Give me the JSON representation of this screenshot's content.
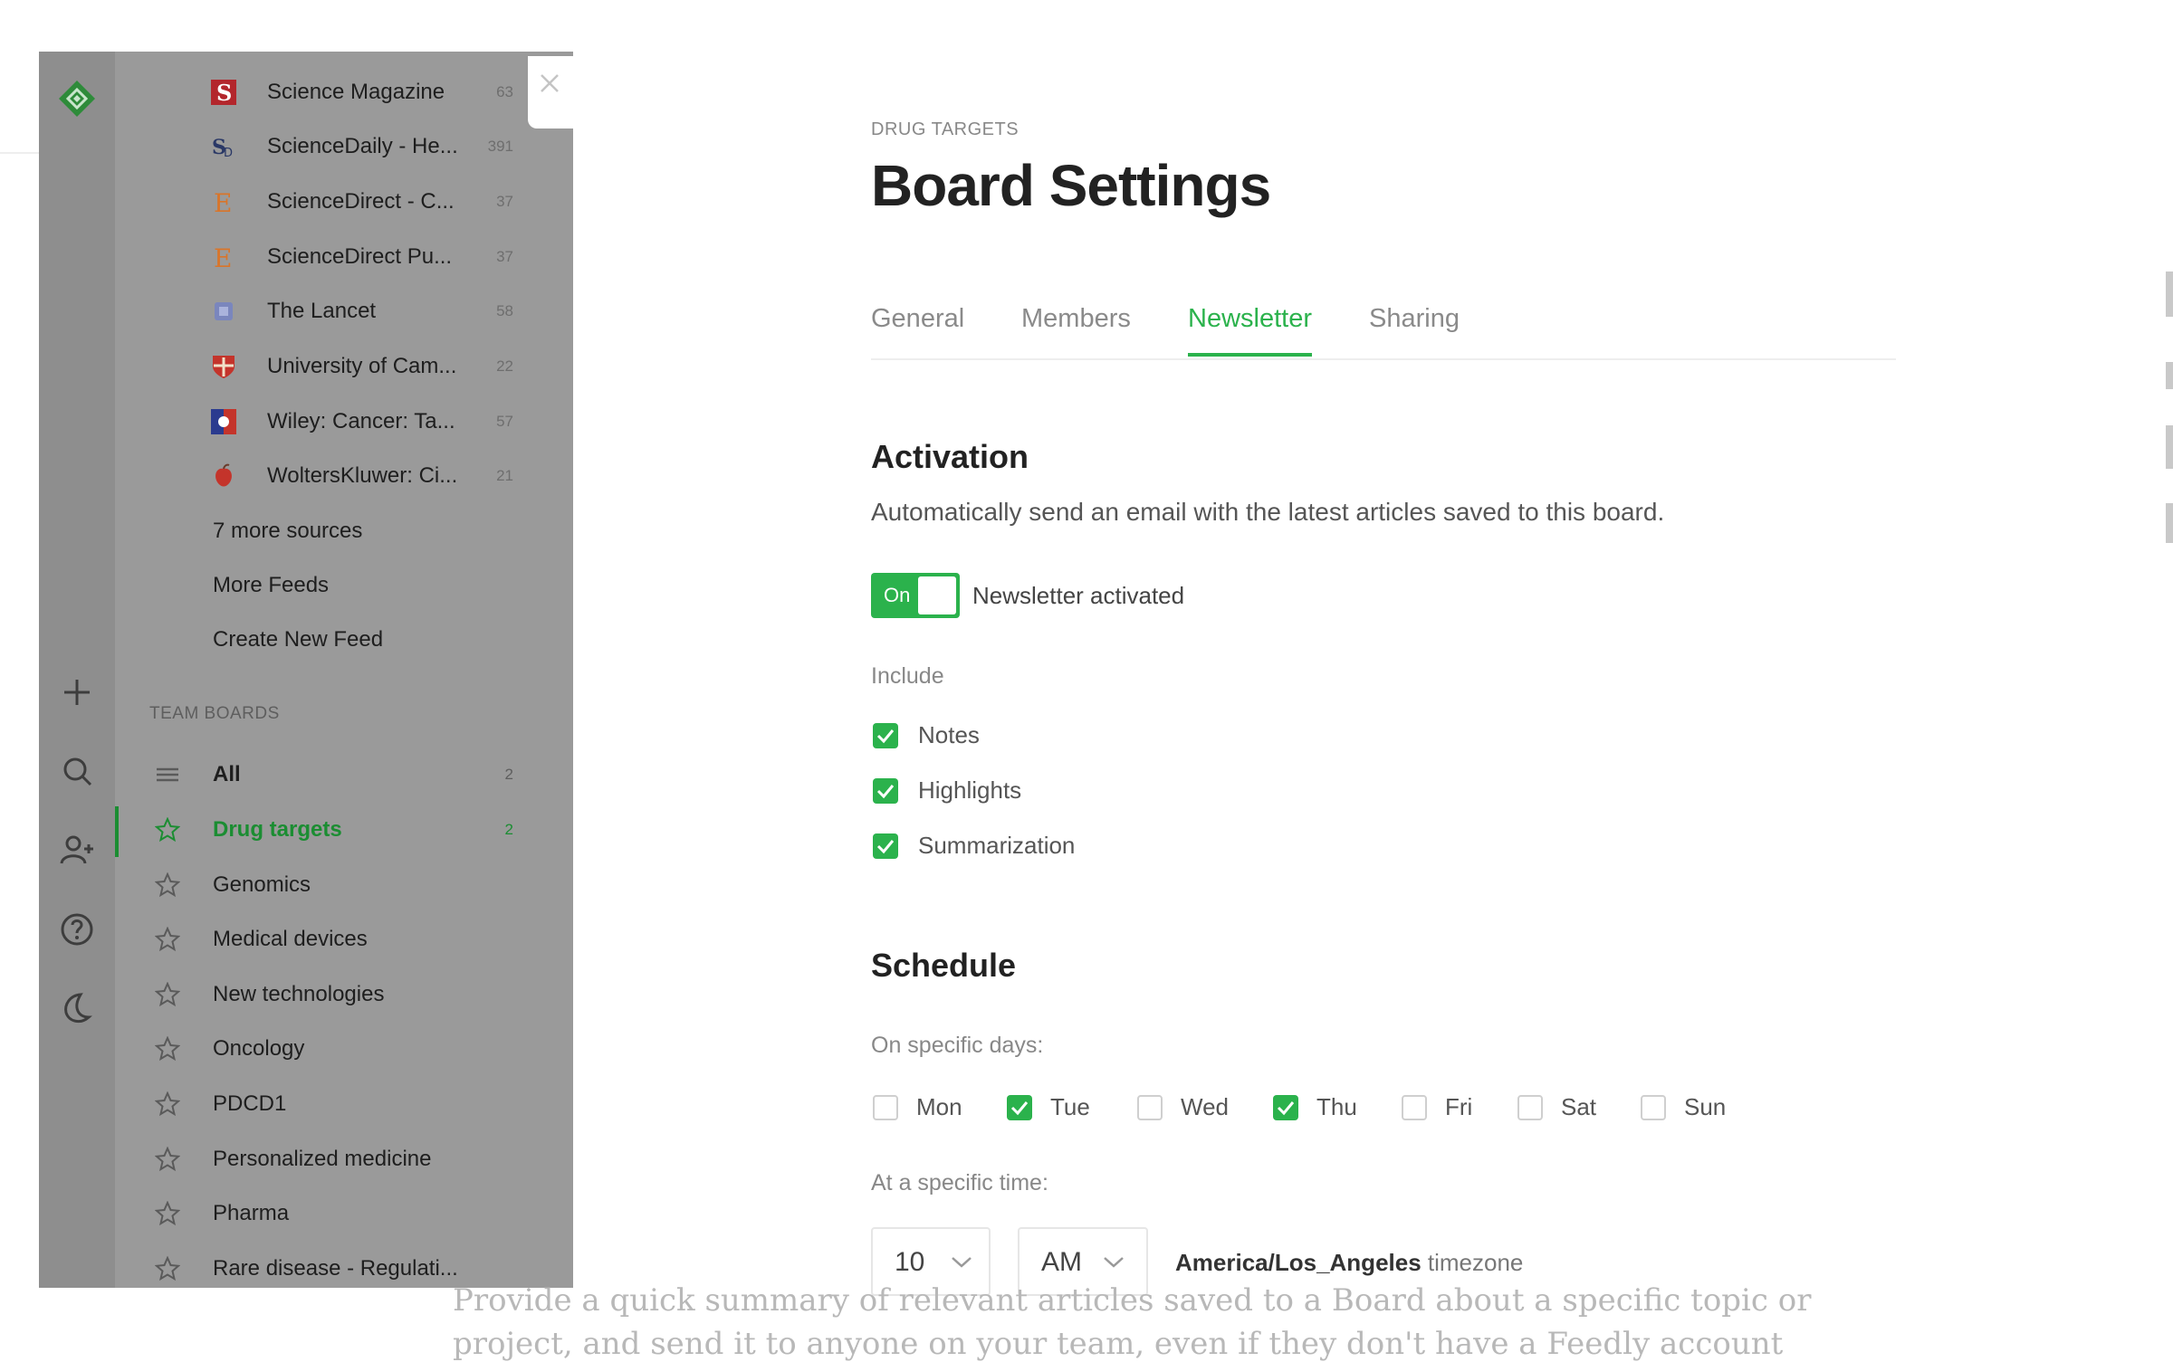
{
  "rail": {
    "icons": [
      "feedly-logo-icon",
      "plus-icon",
      "search-icon",
      "add-user-icon",
      "help-icon",
      "moon-icon"
    ]
  },
  "sidebar": {
    "feeds": [
      {
        "name": "Science Magazine",
        "count": "63",
        "icon": "science-magazine-icon",
        "color": "#c0262d"
      },
      {
        "name": "ScienceDaily - He...",
        "count": "391",
        "icon": "sciencedaily-icon",
        "color": "#3a4a7a"
      },
      {
        "name": "ScienceDirect - C...",
        "count": "37",
        "icon": "elsevier-icon",
        "color": "#e07b2a"
      },
      {
        "name": "ScienceDirect Pu...",
        "count": "37",
        "icon": "elsevier-icon",
        "color": "#e07b2a"
      },
      {
        "name": "The Lancet",
        "count": "58",
        "icon": "lancet-icon",
        "color": "#6b79b8"
      },
      {
        "name": "University of Cam...",
        "count": "22",
        "icon": "cambridge-crest-icon",
        "color": "#c8342b"
      },
      {
        "name": "Wiley: Cancer: Ta...",
        "count": "57",
        "icon": "wiley-icon",
        "color": "#2b3b8f"
      },
      {
        "name": "WoltersKluwer: Ci...",
        "count": "21",
        "icon": "wolters-kluwer-icon",
        "color": "#c8342b"
      }
    ],
    "more_sources": "7 more sources",
    "more_feeds": "More Feeds",
    "create_feed": "Create New Feed",
    "team_boards_label": "TEAM BOARDS",
    "boards": [
      {
        "name": "All",
        "count": "2",
        "icon": "list-icon"
      },
      {
        "name": "Drug targets",
        "count": "2",
        "icon": "star-icon",
        "active": true
      },
      {
        "name": "Genomics",
        "icon": "star-icon"
      },
      {
        "name": "Medical devices",
        "icon": "star-icon"
      },
      {
        "name": "New technologies",
        "icon": "star-icon"
      },
      {
        "name": "Oncology",
        "icon": "star-icon"
      },
      {
        "name": "PDCD1",
        "icon": "star-icon"
      },
      {
        "name": "Personalized medicine",
        "icon": "star-icon"
      },
      {
        "name": "Pharma",
        "icon": "star-icon"
      },
      {
        "name": "Rare disease - Regulati...",
        "icon": "star-icon"
      }
    ]
  },
  "main": {
    "eyebrow": "DRUG TARGETS",
    "title": "Board Settings",
    "tabs": [
      {
        "label": "General"
      },
      {
        "label": "Members"
      },
      {
        "label": "Newsletter",
        "active": true
      },
      {
        "label": "Sharing"
      }
    ],
    "activation": {
      "heading": "Activation",
      "description": "Automatically send an email with the latest articles saved to this board.",
      "toggle_state": "On",
      "toggle_label": "Newsletter activated"
    },
    "include": {
      "label": "Include",
      "options": [
        {
          "label": "Notes",
          "checked": true
        },
        {
          "label": "Highlights",
          "checked": true
        },
        {
          "label": "Summarization",
          "checked": true
        }
      ]
    },
    "schedule": {
      "heading": "Schedule",
      "days_label": "On specific days:",
      "days": [
        {
          "label": "Mon",
          "checked": false
        },
        {
          "label": "Tue",
          "checked": true
        },
        {
          "label": "Wed",
          "checked": false
        },
        {
          "label": "Thu",
          "checked": true
        },
        {
          "label": "Fri",
          "checked": false
        },
        {
          "label": "Sat",
          "checked": false
        },
        {
          "label": "Sun",
          "checked": false
        }
      ],
      "time_label": "At a specific time:",
      "hour": "10",
      "ampm": "AM",
      "timezone_name": "America/Los_Angeles",
      "timezone_suffix": " timezone"
    }
  },
  "promo": {
    "line1": "Provide a quick summary of relevant articles saved to a Board about a specific topic or",
    "line2": "project, and send it to anyone on your team, even if they don't have a Feedly account"
  },
  "colors": {
    "accent": "#2bb24c",
    "sidebar_active": "#1b8d32"
  }
}
